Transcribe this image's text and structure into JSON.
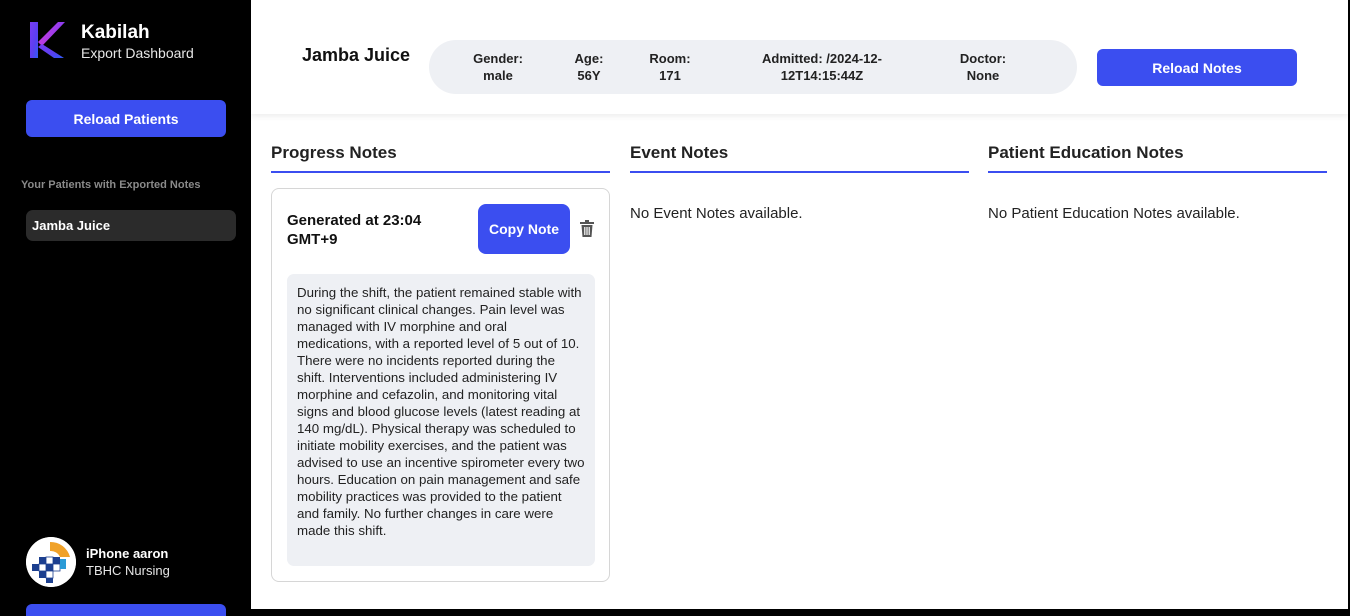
{
  "brand": {
    "name": "Kabilah",
    "subtitle": "Export Dashboard"
  },
  "sidebar": {
    "reload_label": "Reload Patients",
    "patients_heading": "Your Patients with Exported Notes",
    "patients": [
      {
        "name": "Jamba Juice"
      }
    ],
    "user": {
      "name": "iPhone aaron",
      "org": "TBHC Nursing"
    }
  },
  "header": {
    "patient_name": "Jamba Juice",
    "info": {
      "gender_label": "Gender:",
      "gender": "male",
      "age_label": "Age:",
      "age": "56Y",
      "room_label": "Room:",
      "room": "171",
      "admitted_label": "Admitted: /2024-12-",
      "admitted": "12T14:15:44Z",
      "doctor_label": "Doctor:",
      "doctor": "None"
    },
    "reload_notes_label": "Reload Notes"
  },
  "columns": {
    "progress": {
      "title": "Progress Notes",
      "notes": [
        {
          "generated": "Generated at 23:04 GMT+9",
          "copy_label": "Copy Note",
          "body": "During the shift, the patient remained stable with no significant clinical changes. Pain level was managed with  IV morphine and oral medications, with a reported level of 5 out of 10. There were no incidents reported during the shift. Interventions included administering  IV morphine and cefazolin, and monitoring vital signs and blood glucose levels (latest reading at 140 mg/dL). Physical therapy was scheduled to initiate mobility exercises, and the patient was advised to use an incentive spirometer every two hours. Education on pain management and safe mobility practices was provided to the patient and family. No further changes in care were made this shift."
        }
      ]
    },
    "event": {
      "title": "Event Notes",
      "empty": "No Event Notes available."
    },
    "education": {
      "title": "Patient Education Notes",
      "empty": "No Patient Education Notes available."
    }
  },
  "colors": {
    "accent": "#3b4ef0",
    "sidebar_bg": "#000000",
    "pill_bg": "#eef0f4"
  },
  "icons": {
    "delete": "trash-icon",
    "logo": "kabilah-logo-icon",
    "avatar": "tbhc-logo-icon"
  }
}
